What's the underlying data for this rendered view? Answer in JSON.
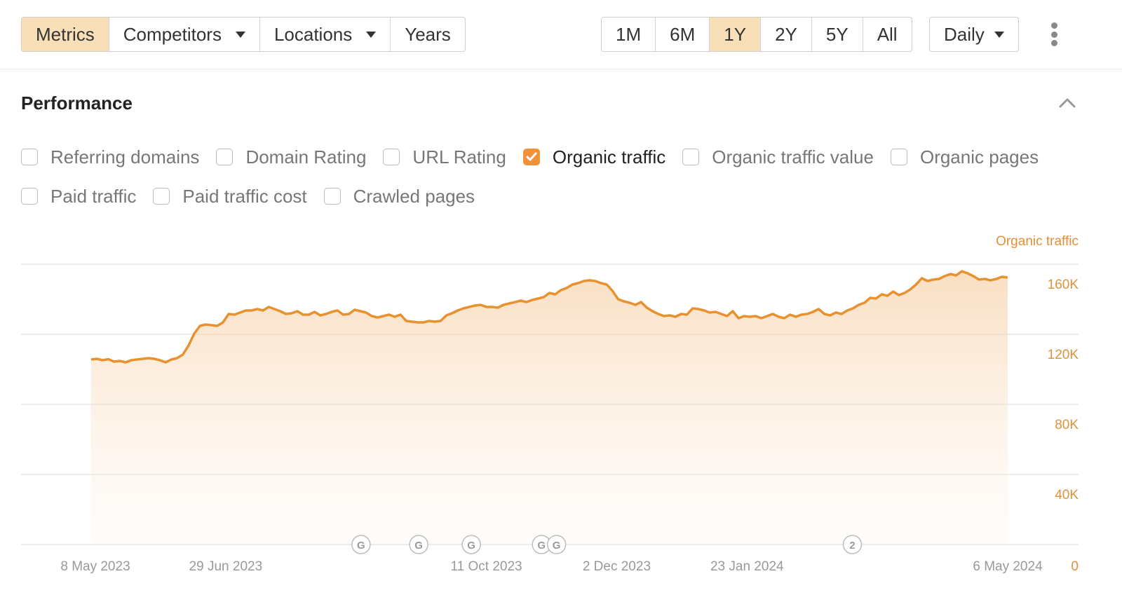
{
  "toolbar": {
    "view_tabs": [
      {
        "label": "Metrics",
        "active": true,
        "dropdown": false
      },
      {
        "label": "Competitors",
        "active": false,
        "dropdown": true
      },
      {
        "label": "Locations",
        "active": false,
        "dropdown": true
      },
      {
        "label": "Years",
        "active": false,
        "dropdown": false
      }
    ],
    "ranges": [
      {
        "label": "1M",
        "active": false
      },
      {
        "label": "6M",
        "active": false
      },
      {
        "label": "1Y",
        "active": true
      },
      {
        "label": "2Y",
        "active": false
      },
      {
        "label": "5Y",
        "active": false
      },
      {
        "label": "All",
        "active": false
      }
    ],
    "interval": "Daily",
    "more_icon": "vertical-ellipsis-icon"
  },
  "section": {
    "title": "Performance",
    "collapse_icon": "chevron-up-icon"
  },
  "metrics": [
    [
      {
        "label": "Referring domains",
        "checked": false
      },
      {
        "label": "Domain Rating",
        "checked": false
      },
      {
        "label": "URL Rating",
        "checked": false
      },
      {
        "label": "Organic traffic",
        "checked": true
      },
      {
        "label": "Organic traffic value",
        "checked": false
      },
      {
        "label": "Organic pages",
        "checked": false
      }
    ],
    [
      {
        "label": "Paid traffic",
        "checked": false
      },
      {
        "label": "Paid traffic cost",
        "checked": false
      },
      {
        "label": "Crawled pages",
        "checked": false
      }
    ]
  ],
  "colors": {
    "accent": "#e8912f",
    "active_bg": "#f8dfb7",
    "checkbox_on": "#f0923a"
  },
  "chart_data": {
    "type": "area",
    "title": "",
    "legend": {
      "label": "Organic traffic",
      "placement": "top-right"
    },
    "xlabel": "",
    "ylabel": "",
    "ylim": [
      0,
      160000
    ],
    "yticks": [
      0,
      40000,
      80000,
      120000,
      160000
    ],
    "ytick_labels": [
      "0",
      "40K",
      "80K",
      "120K",
      "160K"
    ],
    "grid": true,
    "x_start": "2023-05-08",
    "x_end": "2024-05-06",
    "xtick_labels": [
      {
        "label": "8 May 2023",
        "date": "2023-05-08"
      },
      {
        "label": "29 Jun 2023",
        "date": "2023-06-29"
      },
      {
        "label": "11 Oct 2023",
        "date": "2023-10-11"
      },
      {
        "label": "2 Dec 2023",
        "date": "2023-12-02"
      },
      {
        "label": "23 Jan 2024",
        "date": "2024-01-23"
      },
      {
        "label": "6 May 2024",
        "date": "2024-05-06"
      }
    ],
    "annotations": [
      {
        "label": "G",
        "date": "2023-08-22"
      },
      {
        "label": "G",
        "date": "2023-09-14"
      },
      {
        "label": "G",
        "date": "2023-10-05"
      },
      {
        "label": "G",
        "date": "2023-11-02"
      },
      {
        "label": "G",
        "date": "2023-11-08"
      },
      {
        "label": "2",
        "date": "2024-03-05"
      }
    ],
    "series": [
      {
        "name": "Organic traffic",
        "x_step_days": 4,
        "values": [
          105600,
          106000,
          105200,
          105800,
          104400,
          104800,
          104000,
          105200,
          105600,
          106000,
          106400,
          106000,
          105200,
          104000,
          105600,
          106400,
          108400,
          113600,
          120400,
          124800,
          125600,
          125200,
          124800,
          126800,
          131600,
          131200,
          132400,
          133600,
          133600,
          134400,
          133600,
          135600,
          134400,
          133200,
          131600,
          132000,
          133200,
          131200,
          131200,
          132800,
          130800,
          131600,
          132800,
          133600,
          131200,
          131600,
          134000,
          133200,
          132400,
          130400,
          129600,
          130400,
          131200,
          130000,
          131200,
          127600,
          127200,
          126800,
          126800,
          127600,
          127200,
          127600,
          130800,
          132000,
          133600,
          134800,
          135600,
          136400,
          136800,
          135600,
          135600,
          135200,
          136800,
          137600,
          138400,
          139200,
          138400,
          139600,
          140400,
          141200,
          143600,
          142800,
          145200,
          146400,
          148400,
          149200,
          150400,
          150800,
          150400,
          149200,
          148400,
          144800,
          140000,
          138800,
          138000,
          136800,
          138400,
          135200,
          133200,
          131600,
          130400,
          130800,
          130000,
          131600,
          131200,
          134800,
          134400,
          133600,
          132400,
          132800,
          131600,
          130400,
          133200,
          129200,
          130400,
          130000,
          130400,
          129200,
          130400,
          131600,
          130000,
          129200,
          131200,
          130000,
          131200,
          131600,
          132800,
          134400,
          131600,
          130800,
          132400,
          131600,
          133600,
          134800,
          136800,
          138000,
          140800,
          140400,
          142800,
          142000,
          144400,
          142400,
          143600,
          145600,
          148400,
          152000,
          150400,
          151200,
          151600,
          153200,
          154400,
          153600,
          156000,
          154800,
          153200,
          151200,
          151600,
          150800,
          151600,
          152800,
          152400
        ]
      }
    ]
  }
}
